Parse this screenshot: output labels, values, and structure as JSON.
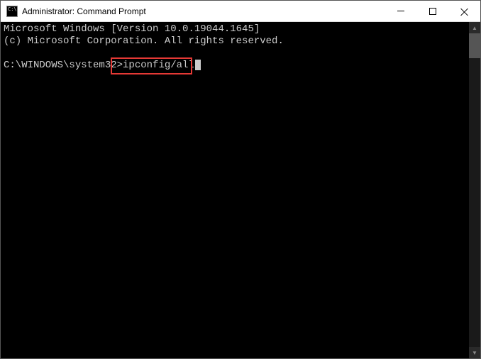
{
  "window": {
    "title": "Administrator: Command Prompt"
  },
  "terminal": {
    "line1": "Microsoft Windows [Version 10.0.19044.1645]",
    "line2": "(c) Microsoft Corporation. All rights reserved.",
    "blank": "",
    "prompt": "C:\\WINDOWS\\system32>",
    "command": "ipconfig/all"
  }
}
